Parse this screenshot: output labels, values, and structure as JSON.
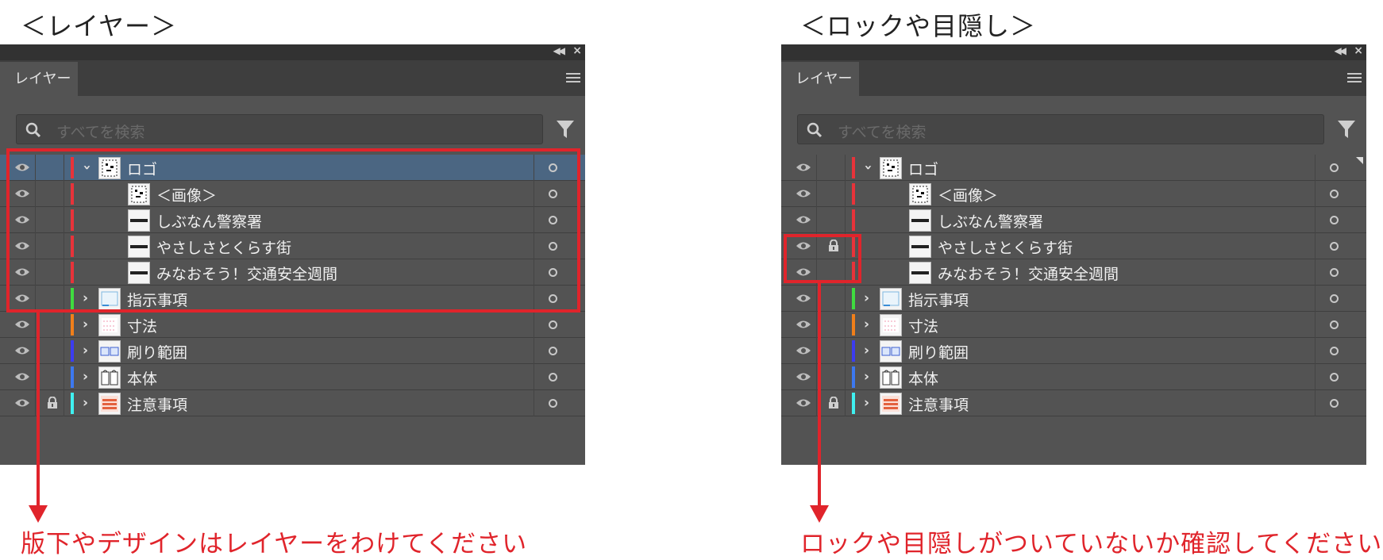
{
  "headings": {
    "left": "＜レイヤー＞",
    "right": "＜ロックや目隠し＞"
  },
  "captions": {
    "left": "版下やデザインはレイヤーをわけてください",
    "right": "ロックや目隠しがついていないか確認してください"
  },
  "accent_color": "#e0242b",
  "panels": [
    {
      "tab": "レイヤー",
      "search_placeholder": "すべてを検索",
      "rows": [
        {
          "name": "ロゴ",
          "color": "#e8333a",
          "level": 0,
          "chevron": "down",
          "locked": false,
          "selected": true,
          "thumb": "logo"
        },
        {
          "name": "＜画像＞",
          "color": "#e8333a",
          "level": 1,
          "chevron": "none",
          "locked": false,
          "selected": false,
          "thumb": "logo"
        },
        {
          "name": "しぶなん警察署",
          "color": "#e8333a",
          "level": 1,
          "chevron": "none",
          "locked": false,
          "selected": false,
          "thumb": "text"
        },
        {
          "name": "やさしさとくらす街",
          "color": "#e8333a",
          "level": 1,
          "chevron": "none",
          "locked": false,
          "selected": false,
          "thumb": "text"
        },
        {
          "name": "みなおそう！交通安全週間",
          "color": "#e8333a",
          "level": 1,
          "chevron": "none",
          "locked": false,
          "selected": false,
          "thumb": "text"
        },
        {
          "name": "指示事項",
          "color": "#3fdc3f",
          "level": 0,
          "chevron": "right",
          "locked": false,
          "selected": false,
          "thumb": "blue"
        },
        {
          "name": "寸法",
          "color": "#f07f1a",
          "level": 0,
          "chevron": "right",
          "locked": false,
          "selected": false,
          "thumb": "pink"
        },
        {
          "name": "刷り範囲",
          "color": "#3c3cf0",
          "level": 0,
          "chevron": "right",
          "locked": false,
          "selected": false,
          "thumb": "boxes"
        },
        {
          "name": "本体",
          "color": "#3c78f0",
          "level": 0,
          "chevron": "right",
          "locked": false,
          "selected": false,
          "thumb": "body"
        },
        {
          "name": "注意事項",
          "color": "#3ff0f0",
          "level": 0,
          "chevron": "right",
          "locked": true,
          "selected": false,
          "thumb": "orange"
        }
      ]
    },
    {
      "tab": "レイヤー",
      "search_placeholder": "すべてを検索",
      "rows": [
        {
          "name": "ロゴ",
          "color": "#e8333a",
          "level": 0,
          "chevron": "down",
          "locked": false,
          "selected": false,
          "thumb": "logo"
        },
        {
          "name": "＜画像＞",
          "color": "#e8333a",
          "level": 1,
          "chevron": "none",
          "locked": false,
          "selected": false,
          "thumb": "logo"
        },
        {
          "name": "しぶなん警察署",
          "color": "#e8333a",
          "level": 1,
          "chevron": "none",
          "locked": false,
          "selected": false,
          "thumb": "text"
        },
        {
          "name": "やさしさとくらす街",
          "color": "#e8333a",
          "level": 1,
          "chevron": "none",
          "locked": true,
          "selected": false,
          "thumb": "text"
        },
        {
          "name": "みなおそう！交通安全週間",
          "color": "#e8333a",
          "level": 1,
          "chevron": "none",
          "locked": false,
          "selected": false,
          "thumb": "text"
        },
        {
          "name": "指示事項",
          "color": "#3fdc3f",
          "level": 0,
          "chevron": "right",
          "locked": false,
          "selected": false,
          "thumb": "blue"
        },
        {
          "name": "寸法",
          "color": "#f07f1a",
          "level": 0,
          "chevron": "right",
          "locked": false,
          "selected": false,
          "thumb": "pink"
        },
        {
          "name": "刷り範囲",
          "color": "#3c3cf0",
          "level": 0,
          "chevron": "right",
          "locked": false,
          "selected": false,
          "thumb": "boxes"
        },
        {
          "name": "本体",
          "color": "#3c78f0",
          "level": 0,
          "chevron": "right",
          "locked": false,
          "selected": false,
          "thumb": "body"
        },
        {
          "name": "注意事項",
          "color": "#3ff0f0",
          "level": 0,
          "chevron": "right",
          "locked": true,
          "selected": false,
          "thumb": "orange"
        }
      ]
    }
  ]
}
